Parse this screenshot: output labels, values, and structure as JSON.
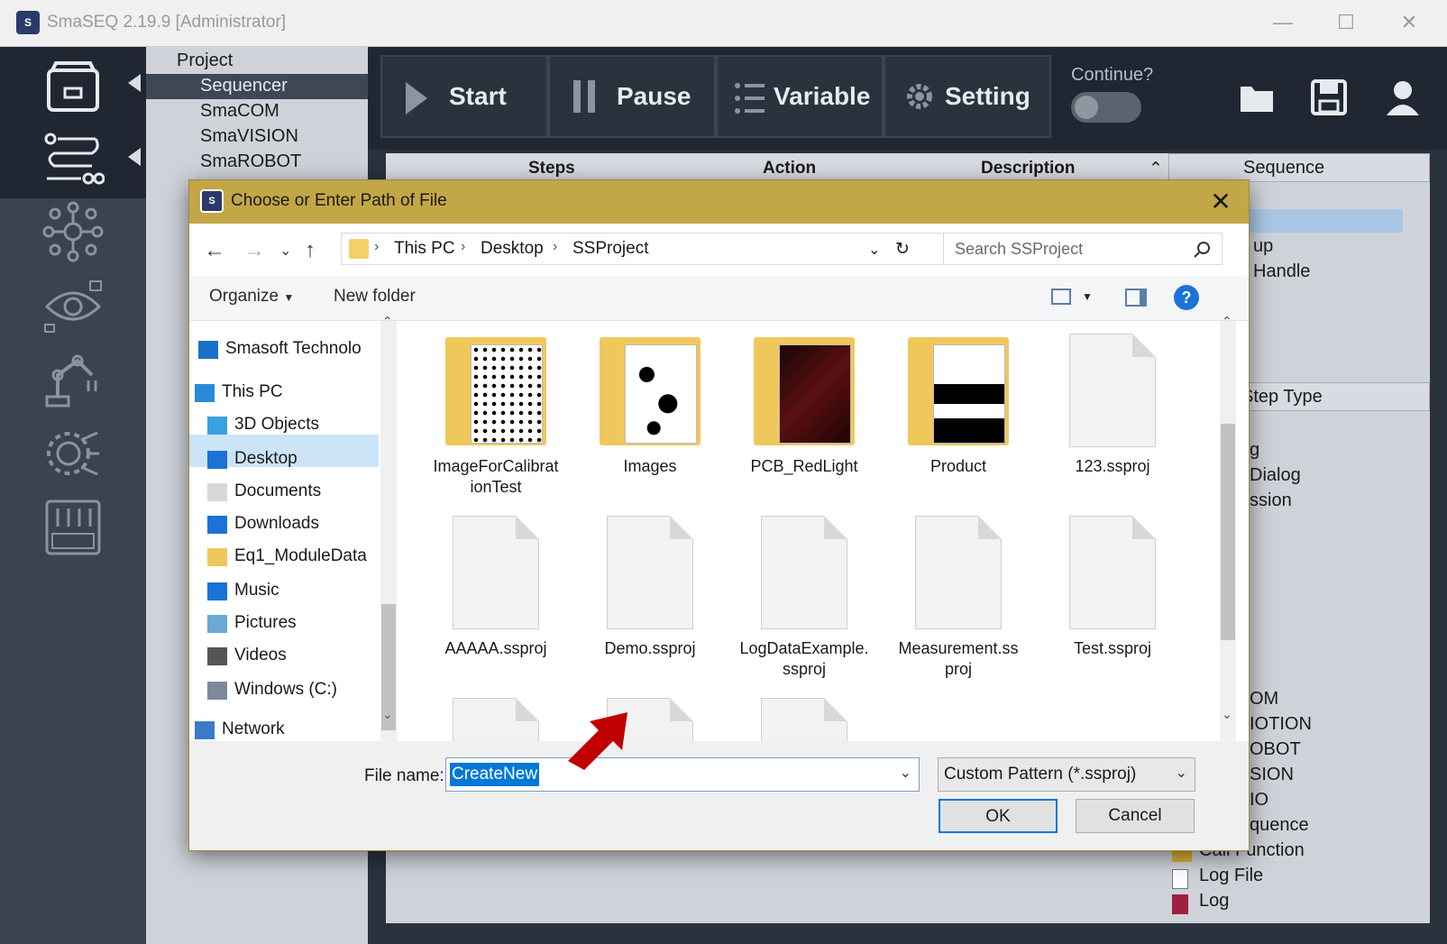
{
  "app": {
    "title": "SmaSEQ 2.19.9 [Administrator]",
    "logo_text": "S"
  },
  "window_controls": {
    "minimize": "—",
    "maximize": "☐",
    "close": "✕"
  },
  "project_tree": {
    "root": "Project",
    "items": [
      "Sequencer",
      "SmaCOM",
      "SmaVISION",
      "SmaROBOT"
    ],
    "selected": "Sequencer"
  },
  "toolbar": {
    "start_label": "Start",
    "pause_label": "Pause",
    "variable_label": "Variable",
    "setting_label": "Setting",
    "continue_label": "Continue?",
    "continue_on": false
  },
  "grid": {
    "columns": [
      "Steps",
      "Action",
      "Description"
    ]
  },
  "sequence_panel": {
    "header": "Sequence",
    "visible_fragments": [
      "up",
      "Handle"
    ],
    "step_type_header": "Step Type",
    "step_type_fragments": [
      "g",
      "Dialog",
      "ssion"
    ],
    "bottom_items": [
      "OM",
      "IOTION",
      "OBOT",
      "SION",
      "IO",
      "quence",
      "Call Function",
      "Log File",
      "Log"
    ]
  },
  "dialog": {
    "title": "Choose or Enter Path of File",
    "close": "✕",
    "breadcrumb": [
      "This PC",
      "Desktop",
      "SSProject"
    ],
    "search_placeholder": "Search SSProject",
    "organize_label": "Organize",
    "new_folder_label": "New folder",
    "help_glyph": "?",
    "nav_pane": [
      {
        "label": "Smasoft Technolo",
        "icon": "building-icon"
      },
      {
        "label": "This PC",
        "icon": "computer-icon"
      },
      {
        "label": "3D Objects",
        "icon": "cube-icon"
      },
      {
        "label": "Desktop",
        "icon": "desktop-icon"
      },
      {
        "label": "Documents",
        "icon": "document-icon"
      },
      {
        "label": "Downloads",
        "icon": "download-icon"
      },
      {
        "label": "Eq1_ModuleData",
        "icon": "folder-icon"
      },
      {
        "label": "Music",
        "icon": "music-icon"
      },
      {
        "label": "Pictures",
        "icon": "picture-icon"
      },
      {
        "label": "Videos",
        "icon": "video-icon"
      },
      {
        "label": "Windows (C:)",
        "icon": "drive-icon"
      },
      {
        "label": "Network",
        "icon": "network-icon"
      }
    ],
    "nav_selected": "Desktop",
    "files": [
      {
        "name_line1": "ImageForCalibrat",
        "name_line2": "ionTest",
        "kind": "folder",
        "style": "dots"
      },
      {
        "name_line1": "Images",
        "name_line2": "",
        "kind": "folder",
        "style": "blobs"
      },
      {
        "name_line1": "PCB_RedLight",
        "name_line2": "",
        "kind": "folder",
        "style": "dark"
      },
      {
        "name_line1": "Product",
        "name_line2": "",
        "kind": "folder",
        "style": "product"
      },
      {
        "name_line1": "123.ssproj",
        "name_line2": "",
        "kind": "file"
      },
      {
        "name_line1": "AAAAA.ssproj",
        "name_line2": "",
        "kind": "file"
      },
      {
        "name_line1": "Demo.ssproj",
        "name_line2": "",
        "kind": "file"
      },
      {
        "name_line1": "LogDataExample.",
        "name_line2": "ssproj",
        "kind": "file"
      },
      {
        "name_line1": "Measurement.ss",
        "name_line2": "proj",
        "kind": "file"
      },
      {
        "name_line1": "Test.ssproj",
        "name_line2": "",
        "kind": "file"
      }
    ],
    "file_name_label": "File name:",
    "file_name_value": "CreateNew",
    "file_type_value": "Custom Pattern (*.ssproj)",
    "ok_label": "OK",
    "cancel_label": "Cancel"
  },
  "colors": {
    "dialog_title_bg": "#c3a646",
    "accent": "#0078d7",
    "annotation_arrow": "#c00000"
  }
}
